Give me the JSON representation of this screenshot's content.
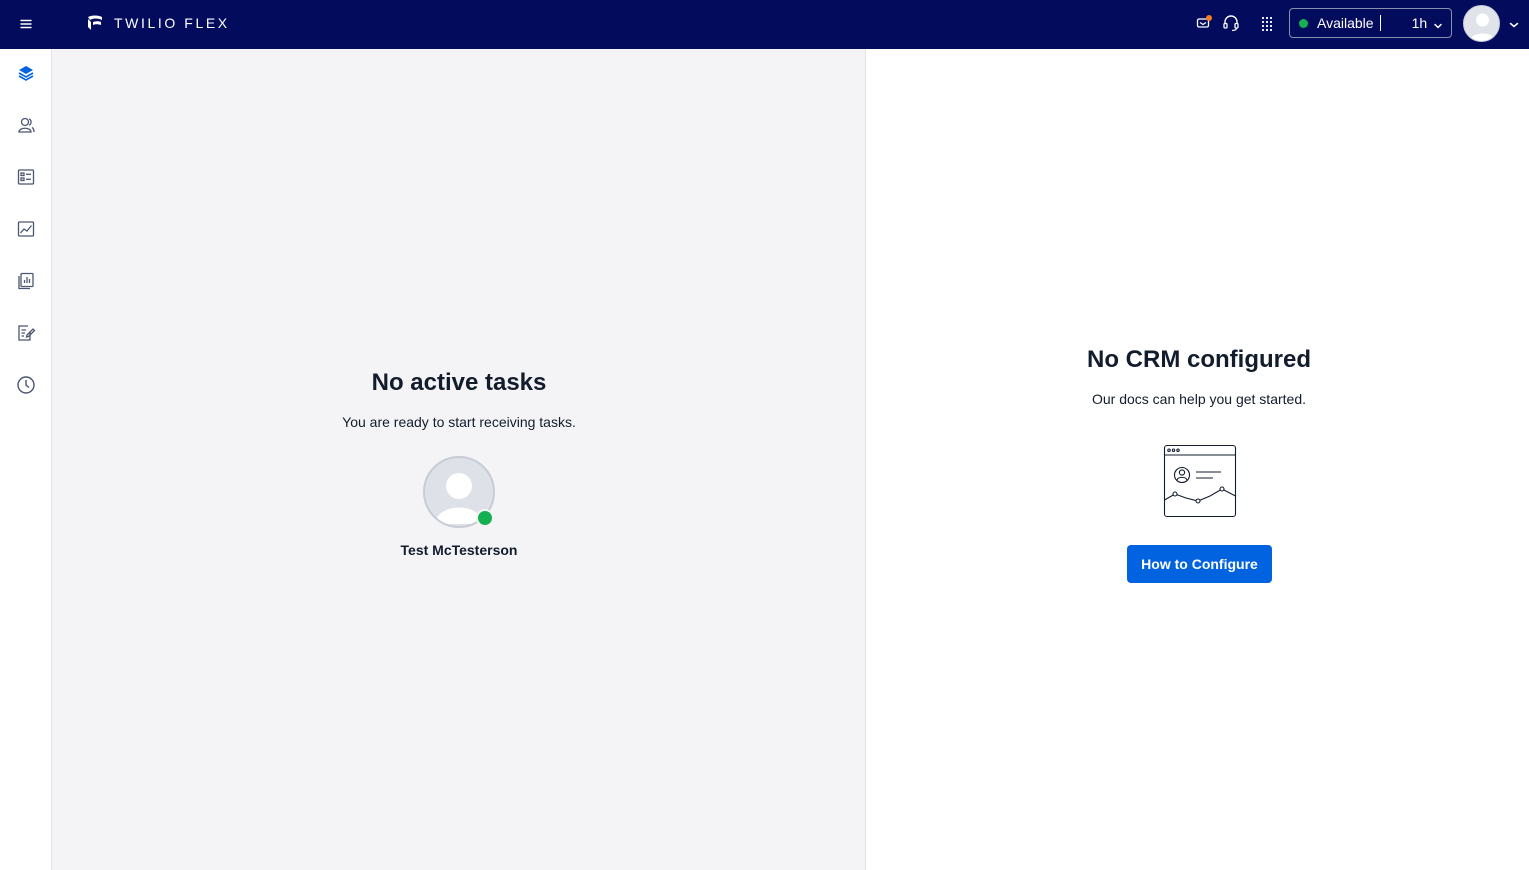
{
  "header": {
    "brand": "TWILIO FLEX",
    "icons": [
      "hamburger-menu-icon",
      "notification-icon",
      "headset-icon",
      "apps-grid-icon"
    ],
    "status": {
      "label": "Available",
      "time": "1h",
      "color": "#14b053"
    }
  },
  "sidebar": {
    "items": [
      {
        "name": "agent-desktop",
        "icon": "layers-icon",
        "active": true
      },
      {
        "name": "teams",
        "icon": "users-icon",
        "active": false
      },
      {
        "name": "queues-stats",
        "icon": "list-card-icon",
        "active": false
      },
      {
        "name": "insights",
        "icon": "chart-icon",
        "active": false
      },
      {
        "name": "reports",
        "icon": "report-icon",
        "active": false
      },
      {
        "name": "quality",
        "icon": "edit-document-icon",
        "active": false
      },
      {
        "name": "history",
        "icon": "clock-icon",
        "active": false
      }
    ]
  },
  "tasks": {
    "title": "No active tasks",
    "subtitle": "You are ready to start receiving tasks.",
    "agent_name": "Test McTesterson"
  },
  "crm": {
    "title": "No CRM configured",
    "subtitle": "Our docs can help you get started.",
    "button_label": "How to Configure"
  },
  "colors": {
    "topbar": "#030b5d",
    "accent": "#0263e0",
    "available": "#14b053"
  }
}
